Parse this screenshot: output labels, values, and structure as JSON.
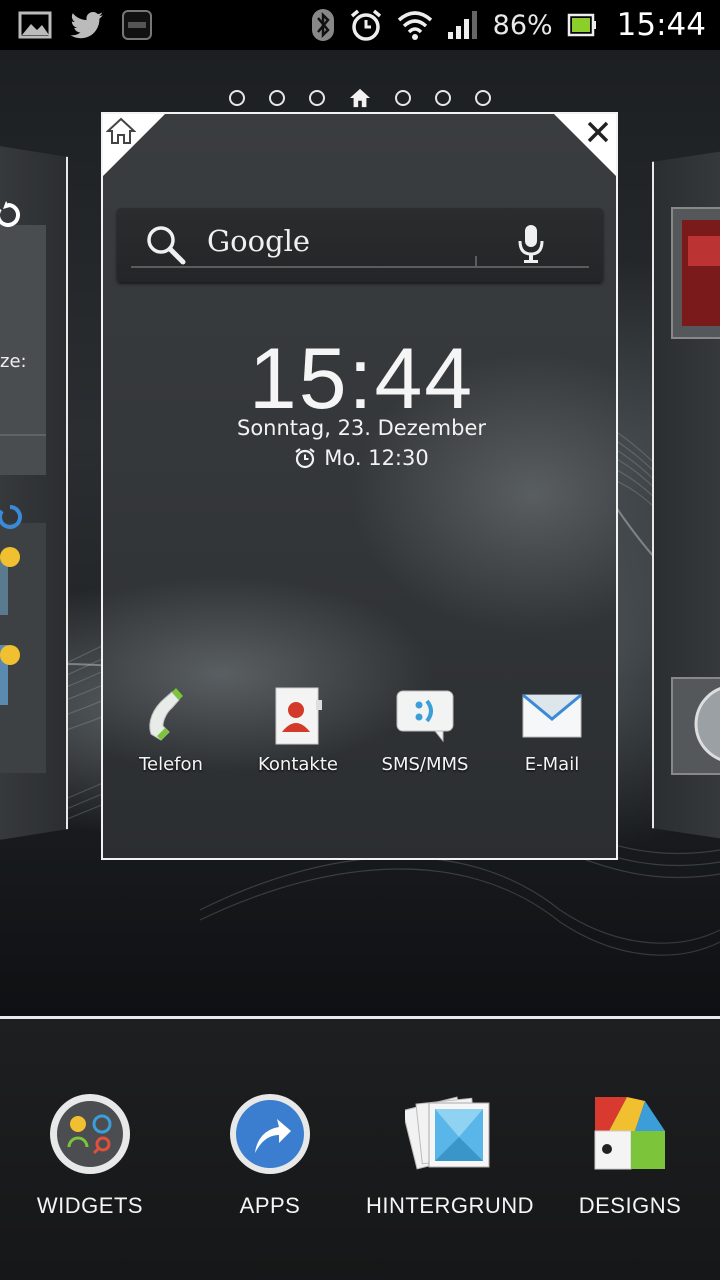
{
  "status_bar": {
    "battery_percent": "86%",
    "time": "15:44",
    "icons": [
      "gallery-icon",
      "twitter-icon",
      "clock-widget-icon",
      "bluetooth-icon",
      "alarm-icon",
      "wifi-icon",
      "signal-icon",
      "battery-icon"
    ]
  },
  "pager": {
    "pages": 7,
    "active_home_index": 3
  },
  "panel": {
    "search": {
      "label": "Google"
    },
    "clock": {
      "time": "15:44",
      "date": "Sonntag, 23. Dezember",
      "alarm": "Mo. 12:30"
    },
    "apps": [
      {
        "label": "Telefon",
        "icon": "phone-icon"
      },
      {
        "label": "Kontakte",
        "icon": "contacts-icon"
      },
      {
        "label": "SMS/MMS",
        "icon": "sms-icon"
      },
      {
        "label": "E-Mail",
        "icon": "email-icon"
      }
    ]
  },
  "side_left": {
    "partial_text": "ze:"
  },
  "tray": {
    "items": [
      {
        "label": "WIDGETS",
        "icon": "widgets-icon"
      },
      {
        "label": "APPS",
        "icon": "apps-icon"
      },
      {
        "label": "HINTERGRUND",
        "icon": "wallpaper-icon"
      },
      {
        "label": "DESIGNS",
        "icon": "designs-icon"
      }
    ]
  },
  "colors": {
    "accent_blue": "#3b8ad8",
    "battery_green": "#8ccf2a"
  }
}
